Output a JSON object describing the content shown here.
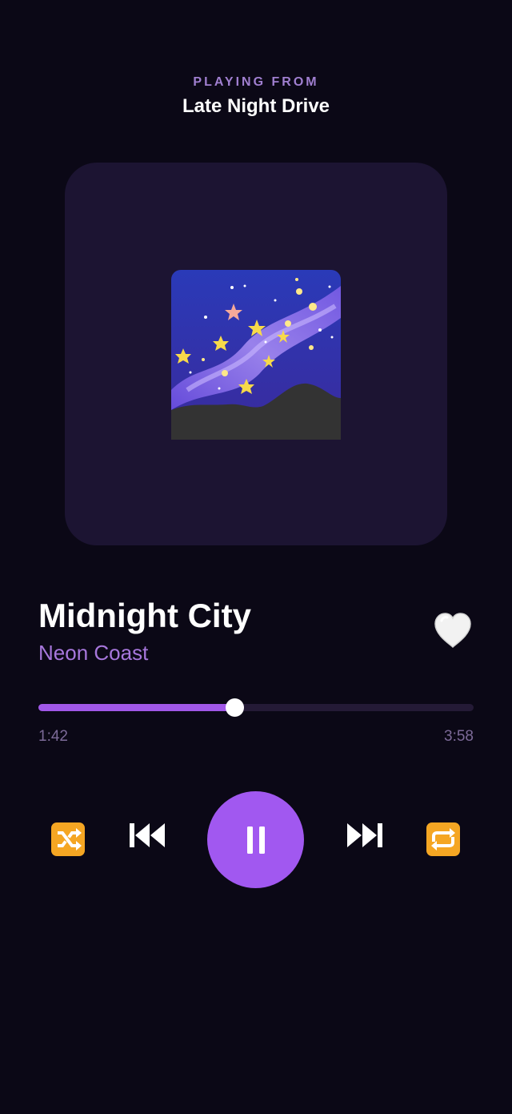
{
  "header": {
    "kicker": "PLAYING FROM",
    "playlist": "Late Night Drive"
  },
  "track": {
    "title": "Midnight City",
    "artist": "Neon Coast",
    "artwork_icon": "milky-way-night-sky-icon",
    "liked_icon": "white-heart-icon"
  },
  "playback": {
    "elapsed": "1:42",
    "duration": "3:58",
    "progress_fraction": 0.45,
    "state": "playing"
  },
  "controls": {
    "shuffle_icon": "shuffle-icon",
    "previous_icon": "previous-track-icon",
    "pause_icon": "pause-icon",
    "next_icon": "next-track-icon",
    "repeat_icon": "repeat-icon"
  },
  "colors": {
    "background": "#0b0816",
    "card": "#1c1432",
    "accent": "#a158e8",
    "kicker": "#a07fd0",
    "artist": "#a777dc",
    "muted_text": "#7c6a98",
    "track_bg": "#241a36",
    "control_orange": "#f5a623"
  }
}
